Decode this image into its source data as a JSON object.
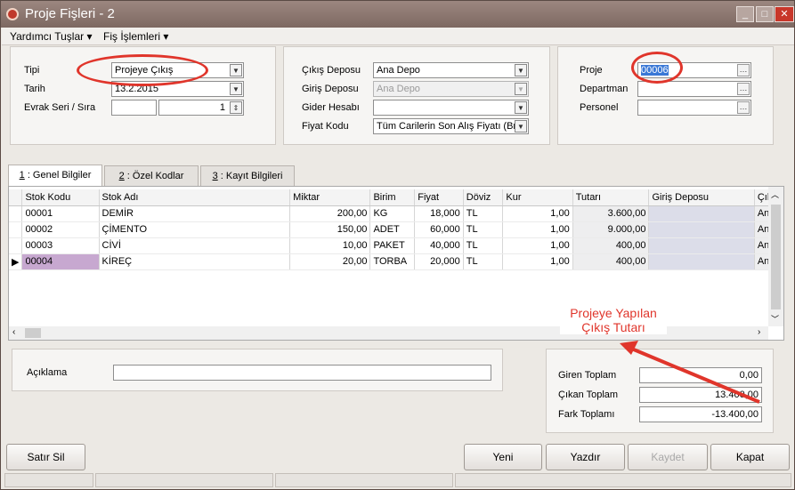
{
  "window": {
    "title": "Proje Fişleri - 2"
  },
  "menu": {
    "helpers_label": "Yardımcı Tuşlar",
    "slip_ops_label": "Fiş İşlemleri"
  },
  "header": {
    "type_label": "Tipi",
    "type_value": "Projeye Çıkış",
    "date_label": "Tarih",
    "date_value": "13.2.2015",
    "doc_label": "Evrak Seri / Sıra",
    "doc_series": "",
    "doc_number": "1",
    "out_depot_label": "Çıkış Deposu",
    "out_depot_value": "Ana Depo",
    "in_depot_label": "Giriş Deposu",
    "in_depot_value": "Ana Depo",
    "expense_label": "Gider Hesabı",
    "expense_value": "",
    "price_label": "Fiyat Kodu",
    "price_value": "Tüm Carilerin Son Alış Fiyatı (Brü",
    "project_label": "Proje",
    "project_value": "00006",
    "department_label": "Departman",
    "department_value": "",
    "staff_label": "Personel",
    "staff_value": ""
  },
  "tabs": [
    {
      "num": "1",
      "label": " : Genel Bilgiler"
    },
    {
      "num": "2",
      "label": " : Özel Kodlar"
    },
    {
      "num": "3",
      "label": " : Kayıt Bilgileri"
    }
  ],
  "grid": {
    "columns": [
      "Stok Kodu",
      "Stok Adı",
      "Miktar",
      "Birim",
      "Fiyat",
      "Döviz",
      "Kur",
      "Tutarı",
      "Giriş Deposu",
      "Çıkış"
    ],
    "rows": [
      [
        "00001",
        "DEMİR",
        "200,00",
        "KG",
        "18,000",
        "TL",
        "1,00",
        "3.600,00",
        "",
        "Ana"
      ],
      [
        "00002",
        "ÇİMENTO",
        "150,00",
        "ADET",
        "60,000",
        "TL",
        "1,00",
        "9.000,00",
        "",
        "Ana"
      ],
      [
        "00003",
        "CİVİ",
        "10,00",
        "PAKET",
        "40,000",
        "TL",
        "1,00",
        "400,00",
        "",
        "Ana"
      ],
      [
        "00004",
        "KİREÇ",
        "20,00",
        "TORBA",
        "20,000",
        "TL",
        "1,00",
        "400,00",
        "",
        "Ana"
      ]
    ]
  },
  "description": {
    "label": "Açıklama",
    "value": ""
  },
  "totals": {
    "in_label": "Giren Toplam",
    "in_value": "0,00",
    "out_label": "Çıkan Toplam",
    "out_value": "13.400,00",
    "diff_label": "Fark Toplamı",
    "diff_value": "-13.400,00"
  },
  "annotation": {
    "line1": "Projeye Yapılan",
    "line2": "Çıkış Tutarı"
  },
  "buttons": {
    "delete_row": "Satır Sil",
    "new": "Yeni",
    "print": "Yazdır",
    "save": "Kaydet",
    "close": "Kapat"
  },
  "colors": {
    "annotation": "#e0352b",
    "selected_cell": "#c7a8d0",
    "title_bar": "#8a746d"
  }
}
